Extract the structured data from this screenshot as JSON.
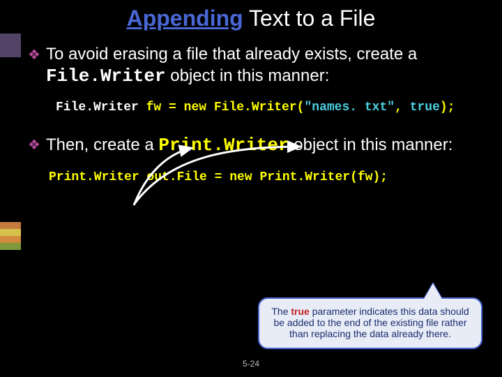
{
  "title": {
    "accent": "Appending",
    "rest": " Text to a File"
  },
  "bullet1": {
    "pre": "To avoid erasing a file that already exists, create a ",
    "mono": "File.Writer",
    "post": " object in this manner:"
  },
  "code1": {
    "type": "File.Writer",
    "assign": "  fw = new File.Writer(",
    "arg": "\"names. txt\"",
    "comma": ", ",
    "true": "true",
    "close": ");"
  },
  "bullet2": {
    "pre": "Then, create a ",
    "mono": "Print.Writer",
    "post": " object in this manner:"
  },
  "code2": "Print.Writer out.File = new Print.Writer(fw);",
  "callout": {
    "t1": "The ",
    "red": "true",
    "t2": " parameter indicates this data should be added to the end of the existing file rather than replacing the data already there."
  },
  "pagenum": "5-24"
}
